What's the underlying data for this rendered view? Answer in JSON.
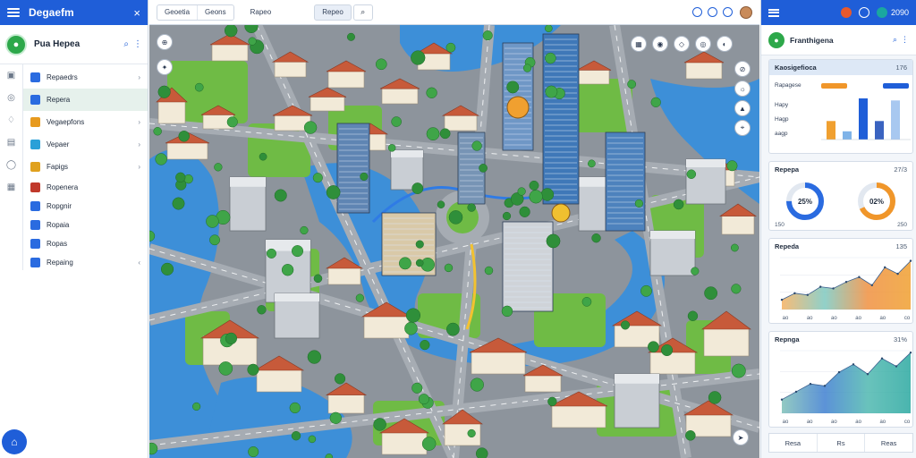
{
  "left_panel": {
    "window_title": "Degaefm",
    "close_icon": "×",
    "app_name": "Pua Hepea",
    "rail_icons": [
      "map-icon",
      "target-icon",
      "drop-icon",
      "chart-icon",
      "circle-icon",
      "grid-icon"
    ],
    "nav_items": [
      {
        "label": "Repaedrs",
        "color": "#2a6be0",
        "chevron": "›",
        "active": false,
        "tall": true
      },
      {
        "label": "Repera",
        "color": "#2a6be0",
        "chevron": "",
        "active": true,
        "tall": true
      },
      {
        "label": "Vegaepfons",
        "color": "#e79a1e",
        "chevron": "›",
        "active": false,
        "tall": true
      },
      {
        "label": "Vepaer",
        "color": "#2aa0d8",
        "chevron": "›",
        "active": false,
        "tall": true
      },
      {
        "label": "Fapigs",
        "color": "#e0a11e",
        "chevron": "›",
        "active": false,
        "tall": true
      },
      {
        "label": "Ropenera",
        "color": "#c0392b",
        "chevron": "",
        "active": false,
        "tall": false
      },
      {
        "label": "Ropgnir",
        "color": "#2a6be0",
        "chevron": "",
        "active": false,
        "tall": false
      },
      {
        "label": "Ropaia",
        "color": "#2a6be0",
        "chevron": "",
        "active": false,
        "tall": false
      },
      {
        "label": "Ropas",
        "color": "#2a6be0",
        "chevron": "",
        "active": false,
        "tall": false
      },
      {
        "label": "Repaing",
        "color": "#2a6be0",
        "chevron": "‹",
        "active": false,
        "tall": false
      }
    ]
  },
  "toolbar": {
    "tab_1": "Geoetia",
    "tab_2": "Geons",
    "tab_3": "Rapeo",
    "search_value": "Repeo",
    "search_icon": "⌕",
    "avatar_name": "avatar"
  },
  "map": {
    "colors": {
      "water": "#3d8fd8",
      "grass": "#6fbb45",
      "road": "#9aa0a6",
      "roof": "#c75a3a"
    }
  },
  "right_panel": {
    "top_value": "2090",
    "title": "Franthigena",
    "card1": {
      "title": "Kaosigefioca",
      "value": "176",
      "rows": [
        {
          "label": "Rapagese",
          "pill": "#f0962a"
        },
        {
          "label": "Hapy",
          "pill": ""
        },
        {
          "label": "Hagp",
          "pill": ""
        },
        {
          "label": "aagp",
          "pill": ""
        }
      ],
      "second_pill": "#1f5ed8",
      "bars": [
        {
          "value": 18,
          "color": "#f0a030"
        },
        {
          "value": 8,
          "color": "#7fb3e8"
        },
        {
          "value": 40,
          "color": "#1f5ed8"
        },
        {
          "value": 18,
          "color": "#3a63c0"
        },
        {
          "value": 38,
          "color": "#a8c8f0"
        }
      ]
    },
    "card2": {
      "title": "Repepa",
      "value": "27/3",
      "gauge_a": {
        "label": "25%",
        "pct": 0.75,
        "color": "#2a6be0"
      },
      "gauge_b": {
        "label": "02%",
        "pct": 0.68,
        "color": "#f0962a"
      },
      "foot_left": "150",
      "foot_right": "250"
    },
    "card3": {
      "title": "Repeda",
      "value": "135",
      "series": [
        12,
        20,
        18,
        28,
        26,
        34,
        40,
        30,
        52,
        44,
        60
      ],
      "tick_labels": [
        "ao",
        "ao",
        "ao",
        "ao",
        "ao",
        "co"
      ]
    },
    "card4": {
      "title": "Repnga",
      "value": "31%",
      "series": [
        14,
        22,
        30,
        28,
        42,
        50,
        40,
        56,
        48,
        62
      ],
      "tick_labels": [
        "ao",
        "ao",
        "ao",
        "ao",
        "ao",
        "co"
      ]
    },
    "bottom_tabs": [
      "Resa",
      "Rs",
      "Reas"
    ]
  }
}
